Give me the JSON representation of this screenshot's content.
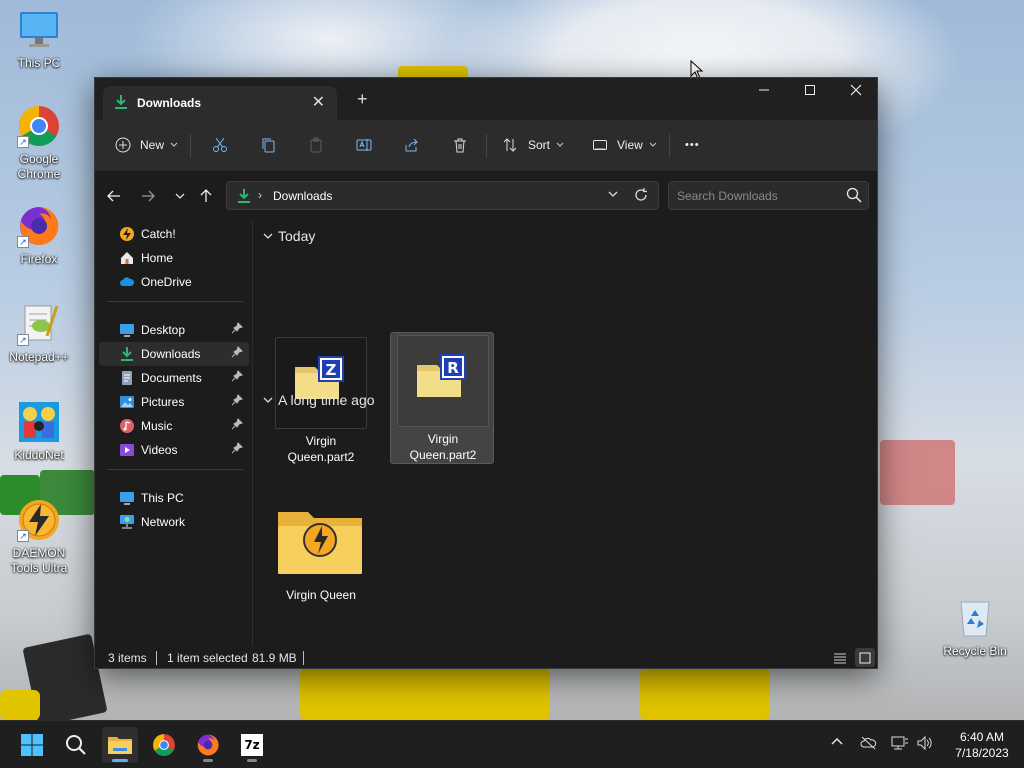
{
  "desktop": {
    "icons": [
      {
        "label": "This PC",
        "icon": "monitor-icon"
      },
      {
        "label": "Google Chrome",
        "icon": "chrome-icon"
      },
      {
        "label": "Firefox",
        "icon": "firefox-icon"
      },
      {
        "label": "Notepad++",
        "icon": "notepadpp-icon"
      },
      {
        "label": "KiddoNet",
        "icon": "kiddonet-icon"
      },
      {
        "label": "DAEMON Tools Ultra",
        "icon": "daemon-tools-icon"
      },
      {
        "label": "Recycle Bin",
        "icon": "recycle-bin-icon"
      }
    ]
  },
  "window": {
    "tab_title": "Downloads",
    "new_tab_glyph": "+",
    "toolbar": {
      "new_label": "New",
      "sort_label": "Sort",
      "view_label": "View",
      "more_glyph": "•••"
    },
    "address": {
      "chevron": "›",
      "path": "Downloads"
    },
    "search": {
      "placeholder": "Search Downloads"
    },
    "nav": {
      "items": [
        {
          "label": "Catch!",
          "icon": "catch-icon"
        },
        {
          "label": "Home",
          "icon": "home-icon"
        },
        {
          "label": "OneDrive",
          "icon": "cloud-icon"
        },
        {
          "label": "Desktop",
          "icon": "desktop-icon",
          "pinned": true
        },
        {
          "label": "Downloads",
          "icon": "download-icon",
          "pinned": true,
          "selected": true
        },
        {
          "label": "Documents",
          "icon": "documents-icon",
          "pinned": true
        },
        {
          "label": "Pictures",
          "icon": "pictures-icon",
          "pinned": true
        },
        {
          "label": "Music",
          "icon": "music-icon",
          "pinned": true
        },
        {
          "label": "Videos",
          "icon": "videos-icon",
          "pinned": true
        },
        {
          "label": "This PC",
          "icon": "monitor-icon"
        },
        {
          "label": "Network",
          "icon": "network-icon"
        }
      ]
    },
    "groups": [
      {
        "label": "Today",
        "files": [
          {
            "name_line1": "Virgin",
            "name_line2": "Queen.part2",
            "badge": "Z",
            "selected": false
          },
          {
            "name_line1": "Virgin",
            "name_line2": "Queen.part2",
            "badge": "R",
            "selected": true
          }
        ]
      },
      {
        "label": "A long time ago",
        "files": [
          {
            "name_line1": "Virgin Queen",
            "name_line2": "",
            "type": "folder"
          }
        ]
      }
    ],
    "status": {
      "items_count": "3 items",
      "selection": "1 item selected",
      "size": "81.9 MB"
    }
  },
  "taskbar": {
    "clock_time": "6:40 AM",
    "clock_date": "7/18/2023",
    "sevenzip_label": "7z"
  },
  "colors": {
    "accent_green": "#2bb673",
    "folder_yellow": "#f2cf5b",
    "selection": "#444444",
    "taskbar_indicator": "#5ab0f0"
  }
}
